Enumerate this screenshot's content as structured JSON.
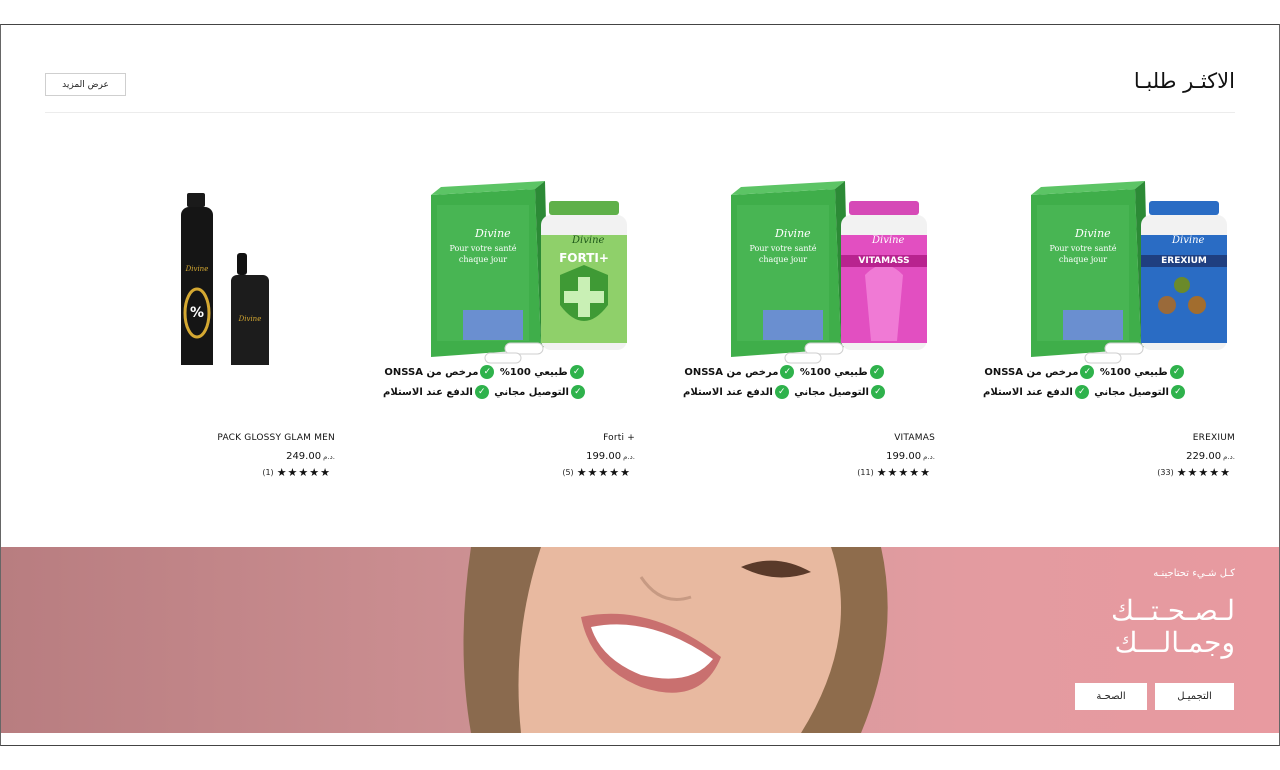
{
  "section": {
    "title": "الاكثـر طلبـا",
    "view_more": "عرض المزيد"
  },
  "badges": {
    "natural": "طبيعي 100%",
    "licensed": "مرخص من ONSSA",
    "cod": "الدفع عند الاستلام",
    "free_delivery": "التوصيل مجاني"
  },
  "products": [
    {
      "name": "EREXIUM",
      "price": "229.00",
      "currency": "د.م.",
      "stars": "★★★★★",
      "count": "(33)",
      "bottle_label": "EREXIUM",
      "bottle_color": "#2a6cc4",
      "brand": "Divine"
    },
    {
      "name": "VITAMAS",
      "price": "199.00",
      "currency": "د.م.",
      "stars": "★★★★★",
      "count": "(11)",
      "bottle_label": "VITAMASS",
      "bottle_color": "#e24fc1",
      "brand": "Divine"
    },
    {
      "name": "Forti +",
      "price": "199.00",
      "currency": "د.م.",
      "stars": "★★★★★",
      "count": "(5)",
      "bottle_label": "FORTI+",
      "bottle_color": "#57a63a",
      "brand": "Divine"
    },
    {
      "name": "PACK GLOSSY GLAM MEN",
      "price": "249.00",
      "currency": "د.م.",
      "stars": "★★★★★",
      "count": "(1)",
      "brand": "Divine"
    }
  ],
  "box": {
    "line1": "Pour votre santé",
    "line2": "chaque jour"
  },
  "banner": {
    "subtitle": "كـل شـيء تحتاجينـه",
    "title_line1": "لـصـحـتــك",
    "title_line2": "وجمـالـــك",
    "btn_beauty": "التجميـل",
    "btn_health": "الصحـة"
  },
  "colors": {
    "banner_left": "#b87d80",
    "banner_right": "#e89aa0",
    "check_green": "#2fb24c"
  }
}
